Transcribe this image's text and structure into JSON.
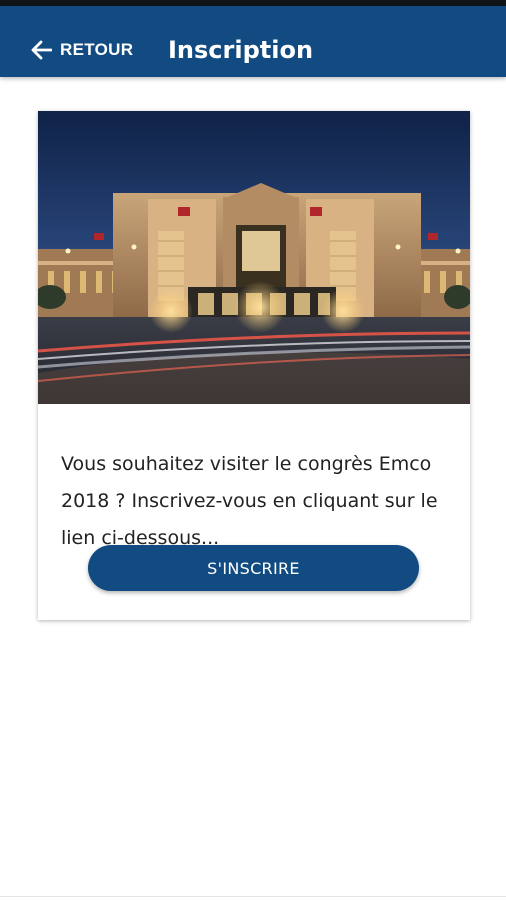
{
  "header": {
    "back_label": "RETOUR",
    "title": "Inscription",
    "color": "#124b82"
  },
  "card": {
    "image_icon": "congress-venue-photo",
    "description": "Vous souhaitez visiter le congrès Emco 2018 ? Inscrivez-vous en cliquant sur le lien ci-dessous...",
    "button_label": "S'INSCRIRE"
  },
  "icons": {
    "back": "arrow-left-icon"
  }
}
